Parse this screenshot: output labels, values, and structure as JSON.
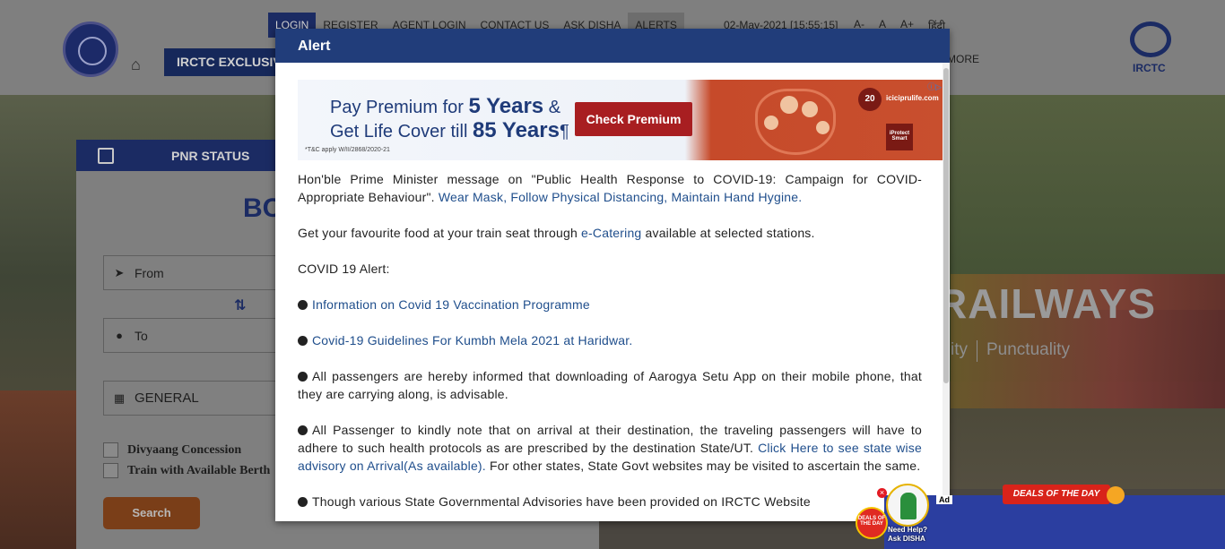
{
  "background": {
    "nav": [
      "LOGIN",
      "REGISTER",
      "AGENT LOGIN",
      "CONTACT US",
      "ASK DISHA",
      "ALERTS"
    ],
    "datetime": "02-May-2021 [15:55:15]",
    "font_controls": [
      "A-",
      "A",
      "A+",
      "हिंदी"
    ],
    "exclusive_label": "IRCTC EXCLUSIVE",
    "more_label": "MORE",
    "right_logo_text": "IRCTC",
    "booking": {
      "tab_label": "PNR STATUS",
      "heading": "BO",
      "from_placeholder": "From",
      "to_placeholder": "To",
      "class_value": "GENERAL",
      "checkbox_1": "Divyaang Concession",
      "checkbox_2": "Train with Available Berth",
      "search_label": "Search"
    },
    "hero_title": "RAILWAYS",
    "tagline": [
      "ity",
      "Punctuality"
    ]
  },
  "modal": {
    "title": "Alert",
    "ad": {
      "line1_pre": "Pay Premium for ",
      "line1_bold": "5 Years",
      "line1_post": " &",
      "line2_pre": "Get Life Cover till ",
      "line2_bold": "85 Years",
      "line2_post": "¶",
      "fine_print": "*T&C apply W/II/2868/2020-21",
      "cta": "Check Premium",
      "badge": "20",
      "url": "iciciprulife.com",
      "product": "iProtect Smart"
    },
    "p1_text": "Hon'ble Prime Minister message on \"Public Health Response to COVID-19: Campaign for COVID-Appropriate Behaviour\". ",
    "p1_link": "Wear Mask, Follow Physical Distancing, Maintain Hand Hygine.",
    "p2_pre": "Get your favourite food at your train seat through ",
    "p2_link": "e-Catering",
    "p2_post": " available at selected stations.",
    "p3_text": "COVID 19 Alert:",
    "p4_link": "Information on Covid 19 Vaccination Programme",
    "p5_link": "Covid-19 Guidelines For Kumbh Mela 2021 at Haridwar.",
    "p6_text": "All passengers are hereby informed that downloading of Aarogya Setu App on their mobile phone, that they are carrying along, is advisable.",
    "p7_text": "All Passenger to kindly note that on arrival at their destination, the traveling passengers will have to adhere to such health protocols as are prescribed by the destination State/UT. ",
    "p7_link": "Click Here to see state wise advisory on Arrival(As available).",
    "p7_post": " For other states, State Govt websites may be visited to ascertain the same.",
    "p8_text": "Though various State Governmental Advisories have been provided on IRCTC Website"
  },
  "overlays": {
    "disha_label_1": "Need Help?",
    "disha_label_2": "Ask DISHA",
    "deal_badge": "DEALS OF THE DAY",
    "ad_tag": "Ad",
    "deal_banner": "DEALS OF THE DAY"
  }
}
